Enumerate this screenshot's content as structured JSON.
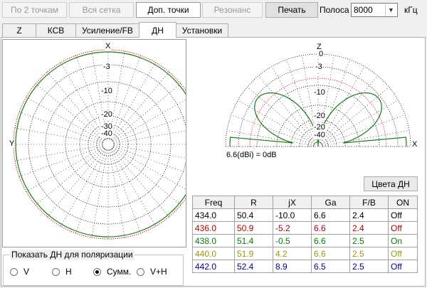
{
  "toolbar": {
    "by2points": "По 2 точкам",
    "whole_grid": "Вся сетка",
    "extra_points": "Доп. точки",
    "resonance": "Резонанс",
    "print": "Печать",
    "band_label": "Полоса",
    "band_value": "8000",
    "unit": "кГц"
  },
  "tabs": [
    "Z",
    "КСВ",
    "Усиление/FB",
    "ДН",
    "Установки"
  ],
  "selected_tab": "ДН",
  "plots": {
    "azimuth": {
      "top_label": "X",
      "left_label": "Y",
      "rings": [
        "-3",
        "-10",
        "-20",
        "-30",
        "-40"
      ]
    },
    "elevation": {
      "top_label": "Z",
      "right_label": "X",
      "rings": [
        "0",
        "-3",
        "-10",
        "-20",
        "-30",
        "-40"
      ]
    },
    "gain_note": "6.6(dBi) = 0dB"
  },
  "colors_button": "Цвета ДН",
  "table": {
    "headers": [
      "Freq",
      "R",
      "jX",
      "Ga",
      "F/B",
      "ON"
    ],
    "rows": [
      {
        "cells": [
          "434.0",
          "50.4",
          "-10.0",
          "6.6",
          "2.4",
          "Off"
        ],
        "color": "#000000"
      },
      {
        "cells": [
          "436.0",
          "50.9",
          "-5.2",
          "6.6",
          "2.4",
          "Off"
        ],
        "color": "#b00000"
      },
      {
        "cells": [
          "438.0",
          "51.4",
          "-0.5",
          "6.6",
          "2.5",
          "On"
        ],
        "color": "#008000"
      },
      {
        "cells": [
          "440.0",
          "51.9",
          "4.2",
          "6.6",
          "2.5",
          "Off"
        ],
        "color": "#9a9a00"
      },
      {
        "cells": [
          "442.0",
          "52.4",
          "8.9",
          "6.5",
          "2.5",
          "Off"
        ],
        "color": "#000090"
      }
    ]
  },
  "polarization": {
    "title": "Показать ДН для поляризации",
    "options": [
      "V",
      "H",
      "Сумм.",
      "V+H"
    ],
    "selected": "Сумм."
  }
}
